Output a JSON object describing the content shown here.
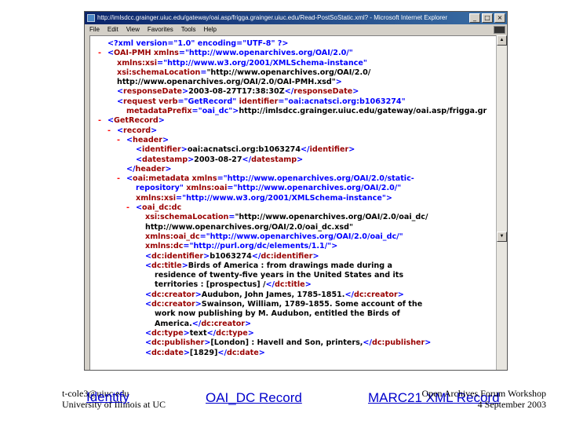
{
  "window": {
    "title": "http://imlsdcc.grainger.uiuc.edu/gateway/oai.asp/frigga.grainger.uiuc.edu/Read-PostSoStatic.xml? - Microsoft Internet Explorer",
    "menu": [
      "File",
      "Edit",
      "View",
      "Favorites",
      "Tools",
      "Help"
    ],
    "controls": [
      "_",
      "□",
      "×"
    ]
  },
  "xml_lines": [
    {
      "indent": 0,
      "marker": "",
      "parts": [
        [
          "pi",
          "<?xml version=\"1.0\" encoding=\"UTF-8\" ?>"
        ]
      ]
    },
    {
      "indent": 0,
      "marker": "-",
      "parts": [
        [
          "mk",
          "<"
        ],
        [
          "t",
          "OAI-PMH"
        ],
        [
          "a",
          " xmlns"
        ],
        [
          "mk",
          "="
        ],
        [
          "q",
          "\"http://www.openarchives.org/OAI/2.0/\""
        ]
      ]
    },
    {
      "indent": 1,
      "marker": "",
      "parts": [
        [
          "a",
          "xmlns:xsi"
        ],
        [
          "mk",
          "="
        ],
        [
          "q",
          "\"http://www.w3.org/2001/XMLSchema-instance\""
        ]
      ]
    },
    {
      "indent": 1,
      "marker": "",
      "parts": [
        [
          "a",
          "xsi:schemaLocation"
        ],
        [
          "mk",
          "="
        ],
        [
          "v",
          "\"http://www.openarchives.org/OAI/2.0/"
        ]
      ]
    },
    {
      "indent": 1,
      "marker": "",
      "parts": [
        [
          "v",
          "http://www.openarchives.org/OAI/2.0/OAI-PMH.xsd\""
        ],
        [
          "mk",
          ">"
        ]
      ]
    },
    {
      "indent": 1,
      "marker": "",
      "parts": [
        [
          "mk",
          "<"
        ],
        [
          "t",
          "responseDate"
        ],
        [
          "mk",
          ">"
        ],
        [
          "tx",
          "2003-08-27T17:38:30Z"
        ],
        [
          "mk",
          "</"
        ],
        [
          "t",
          "responseDate"
        ],
        [
          "mk",
          ">"
        ]
      ]
    },
    {
      "indent": 1,
      "marker": "",
      "parts": [
        [
          "mk",
          "<"
        ],
        [
          "t",
          "request"
        ],
        [
          "a",
          " verb"
        ],
        [
          "mk",
          "="
        ],
        [
          "q",
          "\"GetRecord\""
        ],
        [
          "a",
          " identifier"
        ],
        [
          "mk",
          "="
        ],
        [
          "q",
          "\"oai:acnatsci.org:b1063274\""
        ]
      ]
    },
    {
      "indent": 2,
      "marker": "",
      "parts": [
        [
          "a",
          "metadataPrefix"
        ],
        [
          "mk",
          "="
        ],
        [
          "q",
          "\"oai_dc\""
        ],
        [
          "mk",
          ">"
        ],
        [
          "tx",
          "http://imlsdcc.grainger.uiuc.edu/gateway/oai.asp/frigga.gr"
        ]
      ]
    },
    {
      "indent": 0,
      "marker": "-",
      "parts": [
        [
          "mk",
          "<"
        ],
        [
          "t",
          "GetRecord"
        ],
        [
          "mk",
          ">"
        ]
      ]
    },
    {
      "indent": 1,
      "marker": "-",
      "parts": [
        [
          "mk",
          "<"
        ],
        [
          "t",
          "record"
        ],
        [
          "mk",
          ">"
        ]
      ]
    },
    {
      "indent": 2,
      "marker": "-",
      "parts": [
        [
          "mk",
          "<"
        ],
        [
          "t",
          "header"
        ],
        [
          "mk",
          ">"
        ]
      ]
    },
    {
      "indent": 3,
      "marker": "",
      "parts": [
        [
          "mk",
          "<"
        ],
        [
          "t",
          "identifier"
        ],
        [
          "mk",
          ">"
        ],
        [
          "tx",
          "oai:acnatsci.org:b1063274"
        ],
        [
          "mk",
          "</"
        ],
        [
          "t",
          "identifier"
        ],
        [
          "mk",
          ">"
        ]
      ]
    },
    {
      "indent": 3,
      "marker": "",
      "parts": [
        [
          "mk",
          "<"
        ],
        [
          "t",
          "datestamp"
        ],
        [
          "mk",
          ">"
        ],
        [
          "tx",
          "2003-08-27"
        ],
        [
          "mk",
          "</"
        ],
        [
          "t",
          "datestamp"
        ],
        [
          "mk",
          ">"
        ]
      ]
    },
    {
      "indent": 2,
      "marker": "",
      "parts": [
        [
          "mk",
          "</"
        ],
        [
          "t",
          "header"
        ],
        [
          "mk",
          ">"
        ]
      ]
    },
    {
      "indent": 2,
      "marker": "-",
      "parts": [
        [
          "mk",
          "<"
        ],
        [
          "t",
          "oai:metadata"
        ],
        [
          "a",
          " xmlns"
        ],
        [
          "mk",
          "="
        ],
        [
          "q",
          "\"http://www.openarchives.org/OAI/2.0/static-"
        ]
      ]
    },
    {
      "indent": 3,
      "marker": "",
      "parts": [
        [
          "q",
          "repository\""
        ],
        [
          "a",
          " xmlns:oai"
        ],
        [
          "mk",
          "="
        ],
        [
          "q",
          "\"http://www.openarchives.org/OAI/2.0/\""
        ]
      ]
    },
    {
      "indent": 3,
      "marker": "",
      "parts": [
        [
          "a",
          "xmlns:xsi"
        ],
        [
          "mk",
          "="
        ],
        [
          "q",
          "\"http://www.w3.org/2001/XMLSchema-instance\""
        ],
        [
          "mk",
          ">"
        ]
      ]
    },
    {
      "indent": 3,
      "marker": "-",
      "parts": [
        [
          "mk",
          "<"
        ],
        [
          "t",
          "oai_dc:dc"
        ]
      ]
    },
    {
      "indent": 4,
      "marker": "",
      "parts": [
        [
          "a",
          "xsi:schemaLocation"
        ],
        [
          "mk",
          "="
        ],
        [
          "v",
          "\"http://www.openarchives.org/OAI/2.0/oai_dc/"
        ]
      ]
    },
    {
      "indent": 4,
      "marker": "",
      "parts": [
        [
          "v",
          "http://www.openarchives.org/OAI/2.0/oai_dc.xsd\""
        ]
      ]
    },
    {
      "indent": 4,
      "marker": "",
      "parts": [
        [
          "a",
          "xmlns:oai_dc"
        ],
        [
          "mk",
          "="
        ],
        [
          "q",
          "\"http://www.openarchives.org/OAI/2.0/oai_dc/\""
        ]
      ]
    },
    {
      "indent": 4,
      "marker": "",
      "parts": [
        [
          "a",
          "xmlns:dc"
        ],
        [
          "mk",
          "="
        ],
        [
          "q",
          "\"http://purl.org/dc/elements/1.1/\""
        ],
        [
          "mk",
          ">"
        ]
      ]
    },
    {
      "indent": 4,
      "marker": "",
      "parts": [
        [
          "mk",
          "<"
        ],
        [
          "t",
          "dc:identifier"
        ],
        [
          "mk",
          ">"
        ],
        [
          "tx",
          "b1063274"
        ],
        [
          "mk",
          "</"
        ],
        [
          "t",
          "dc:identifier"
        ],
        [
          "mk",
          ">"
        ]
      ]
    },
    {
      "indent": 4,
      "marker": "",
      "parts": [
        [
          "mk",
          "<"
        ],
        [
          "t",
          "dc:title"
        ],
        [
          "mk",
          ">"
        ],
        [
          "tx",
          "Birds of America : from drawings made during a"
        ]
      ]
    },
    {
      "indent": 5,
      "marker": "",
      "parts": [
        [
          "tx",
          "residence of twenty-five years in the United States and its"
        ]
      ]
    },
    {
      "indent": 5,
      "marker": "",
      "parts": [
        [
          "tx",
          "territories : [prospectus] /"
        ],
        [
          "mk",
          "</"
        ],
        [
          "t",
          "dc:title"
        ],
        [
          "mk",
          ">"
        ]
      ]
    },
    {
      "indent": 4,
      "marker": "",
      "parts": [
        [
          "mk",
          "<"
        ],
        [
          "t",
          "dc:creator"
        ],
        [
          "mk",
          ">"
        ],
        [
          "tx",
          "Audubon, John James, 1785-1851."
        ],
        [
          "mk",
          "</"
        ],
        [
          "t",
          "dc:creator"
        ],
        [
          "mk",
          ">"
        ]
      ]
    },
    {
      "indent": 4,
      "marker": "",
      "parts": [
        [
          "mk",
          "<"
        ],
        [
          "t",
          "dc:creator"
        ],
        [
          "mk",
          ">"
        ],
        [
          "tx",
          "Swainson, William, 1789-1855. Some account of the"
        ]
      ]
    },
    {
      "indent": 5,
      "marker": "",
      "parts": [
        [
          "tx",
          "work now publishing by M. Audubon, entitled the Birds of"
        ]
      ]
    },
    {
      "indent": 5,
      "marker": "",
      "parts": [
        [
          "tx",
          "America."
        ],
        [
          "mk",
          "</"
        ],
        [
          "t",
          "dc:creator"
        ],
        [
          "mk",
          ">"
        ]
      ]
    },
    {
      "indent": 4,
      "marker": "",
      "parts": [
        [
          "mk",
          "<"
        ],
        [
          "t",
          "dc:type"
        ],
        [
          "mk",
          ">"
        ],
        [
          "tx",
          "text"
        ],
        [
          "mk",
          "</"
        ],
        [
          "t",
          "dc:type"
        ],
        [
          "mk",
          ">"
        ]
      ]
    },
    {
      "indent": 4,
      "marker": "",
      "parts": [
        [
          "mk",
          "<"
        ],
        [
          "t",
          "dc:publisher"
        ],
        [
          "mk",
          ">"
        ],
        [
          "tx",
          "[London] : Havell and Son, printers,"
        ],
        [
          "mk",
          "</"
        ],
        [
          "t",
          "dc:publisher"
        ],
        [
          "mk",
          ">"
        ]
      ]
    },
    {
      "indent": 4,
      "marker": "",
      "parts": [
        [
          "mk",
          "<"
        ],
        [
          "t",
          "dc:date"
        ],
        [
          "mk",
          ">"
        ],
        [
          "tx",
          "[1829]"
        ],
        [
          "mk",
          "</"
        ],
        [
          "t",
          "dc:date"
        ],
        [
          "mk",
          ">"
        ]
      ]
    }
  ],
  "footer": {
    "left_line1": "t-cole3@uiuc.edu",
    "left_line2": "University of Illinois at UC",
    "link_identify": "Identify",
    "link_oai_dc": "OAI_DC Record",
    "link_marc": "MARC21 XML Record",
    "right_line1": "Open Archives Forum Workshop",
    "right_line2": "4 September 2003"
  }
}
